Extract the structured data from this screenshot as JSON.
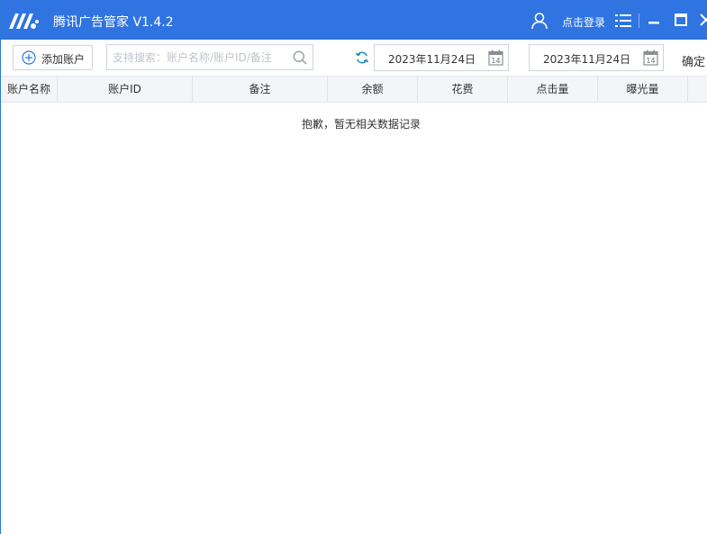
{
  "app": {
    "title": "腾讯广告管家 V1.4.2",
    "login_label": "点击登录",
    "accent_color": "#2f74e0"
  },
  "icons": {
    "logo": "tencent-ad-logo",
    "user": "user-icon",
    "menu": "menu-list-icon",
    "minimize": "minimize-icon",
    "maximize": "maximize-icon",
    "close": "close-icon",
    "add": "plus-circle-icon",
    "search": "search-icon",
    "refresh": "refresh-icon",
    "calendar": "calendar-icon"
  },
  "toolbar": {
    "add_account_label": "添加账户",
    "search": {
      "placeholder": "支持搜索：账户名称/账户ID/备注",
      "value": ""
    },
    "start_date": "2023年11月24日",
    "end_date": "2023年11月24日",
    "calendar_day": "14",
    "confirm_label": "确定"
  },
  "table": {
    "columns": [
      "账户名称",
      "账户ID",
      "备注",
      "余额",
      "花费",
      "点击量",
      "曝光量",
      ""
    ],
    "rows": [],
    "empty_message": "抱歉，暂无相关数据记录"
  }
}
